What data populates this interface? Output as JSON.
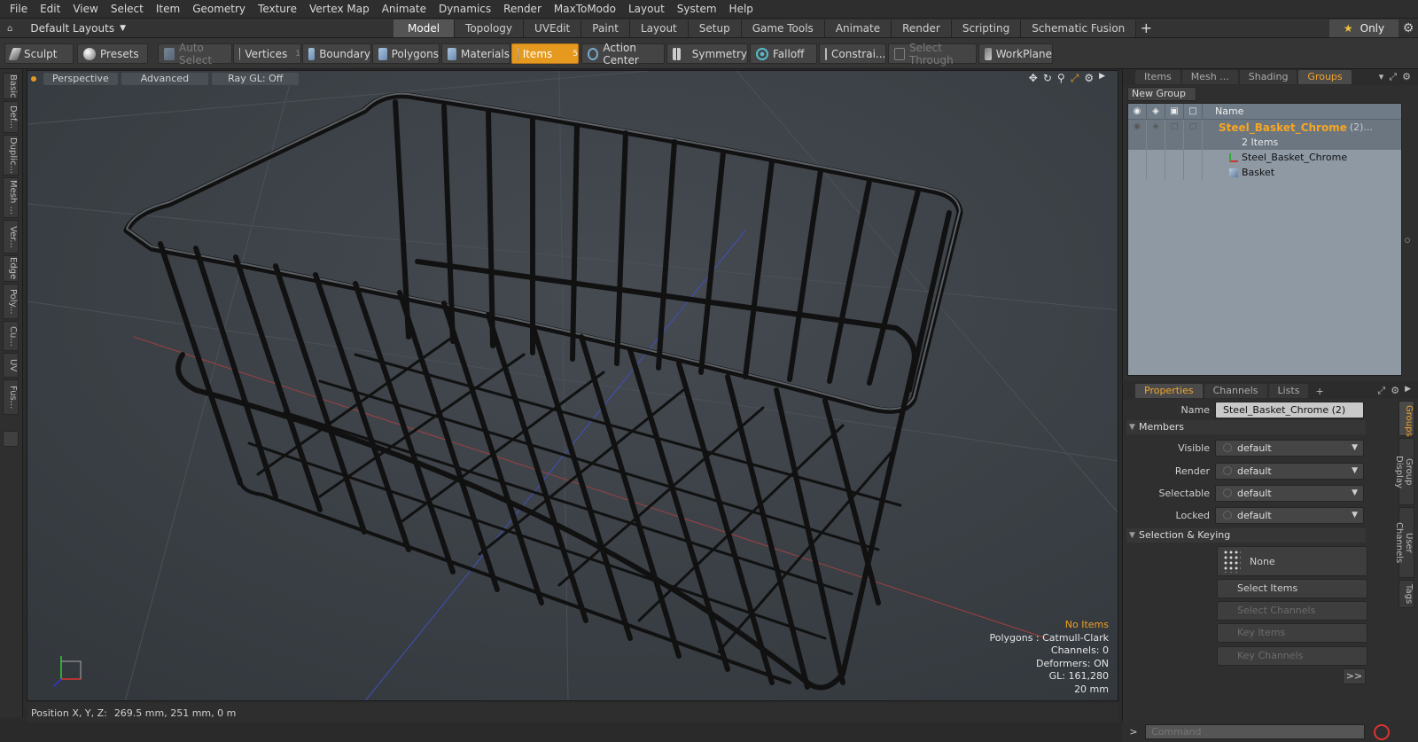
{
  "menu": [
    "File",
    "Edit",
    "View",
    "Select",
    "Item",
    "Geometry",
    "Texture",
    "Vertex Map",
    "Animate",
    "Dynamics",
    "Render",
    "MaxToModo",
    "Layout",
    "System",
    "Help"
  ],
  "layout": {
    "selector": "Default Layouts",
    "tabs": [
      "Model",
      "Topology",
      "UVEdit",
      "Paint",
      "Layout",
      "Setup",
      "Game Tools",
      "Animate",
      "Render",
      "Scripting",
      "Schematic Fusion"
    ],
    "active_tab": "Model",
    "only_label": "Only"
  },
  "toolbar": {
    "sculpt": "Sculpt",
    "presets": "Presets",
    "auto_select": "Auto Select",
    "vertices": "Vertices",
    "vertices_count": "1",
    "boundary": "Boundary",
    "polygons": "Polygons",
    "materials": "Materials",
    "items": "Items",
    "items_count": "5",
    "action_center": "Action Center",
    "symmetry": "Symmetry",
    "falloff": "Falloff",
    "constraints": "Constrai...",
    "select_through": "Select Through",
    "workplane": "WorkPlane"
  },
  "left_tabs": [
    "Basic",
    "Def...",
    "Duplic...",
    "Mesh ...",
    "Ver...",
    "Edge",
    "Poly...",
    "Cu...",
    "UV",
    "Fus..."
  ],
  "viewport": {
    "view_mode": "Perspective",
    "advanced": "Advanced",
    "raygl": "Ray GL: Off",
    "info": {
      "selection": "No Items",
      "polygons": "Polygons : Catmull-Clark",
      "channels": "Channels: 0",
      "deformers": "Deformers: ON",
      "gl": "GL: 161,280",
      "scale": "20 mm"
    },
    "accent": "#f0a020"
  },
  "status": {
    "position_label": "Position X, Y, Z:",
    "position_value": "269.5 mm, 251 mm, 0 m"
  },
  "upper_panel": {
    "tabs": [
      "Items",
      "Mesh ...",
      "Shading",
      "Groups"
    ],
    "active_tab": "Groups",
    "new_group": "New Group",
    "name_header": "Name",
    "group": {
      "name": "Steel_Basket_Chrome",
      "count_suffix": "(2)...",
      "items_label": "2 Items",
      "members": [
        "Steel_Basket_Chrome",
        "Basket"
      ]
    }
  },
  "properties": {
    "tabs": [
      "Properties",
      "Channels",
      "Lists"
    ],
    "active_tab": "Properties",
    "name_label": "Name",
    "name_value": "Steel_Basket_Chrome (2)",
    "members_section": "Members",
    "fields": [
      {
        "label": "Visible",
        "value": "default"
      },
      {
        "label": "Render",
        "value": "default"
      },
      {
        "label": "Selectable",
        "value": "default"
      },
      {
        "label": "Locked",
        "value": "default"
      }
    ],
    "selection_section": "Selection & Keying",
    "none_label": "None",
    "buttons": {
      "select_items": "Select Items",
      "select_channels": "Select Channels",
      "key_items": "Key Items",
      "key_channels": "Key Channels",
      "more": ">>"
    },
    "side_tabs": [
      "Groups",
      "Group Display",
      "User Channels",
      "Tags"
    ],
    "active_side_tab": "Groups"
  },
  "command": {
    "placeholder": "Command",
    "arrow": ">"
  }
}
